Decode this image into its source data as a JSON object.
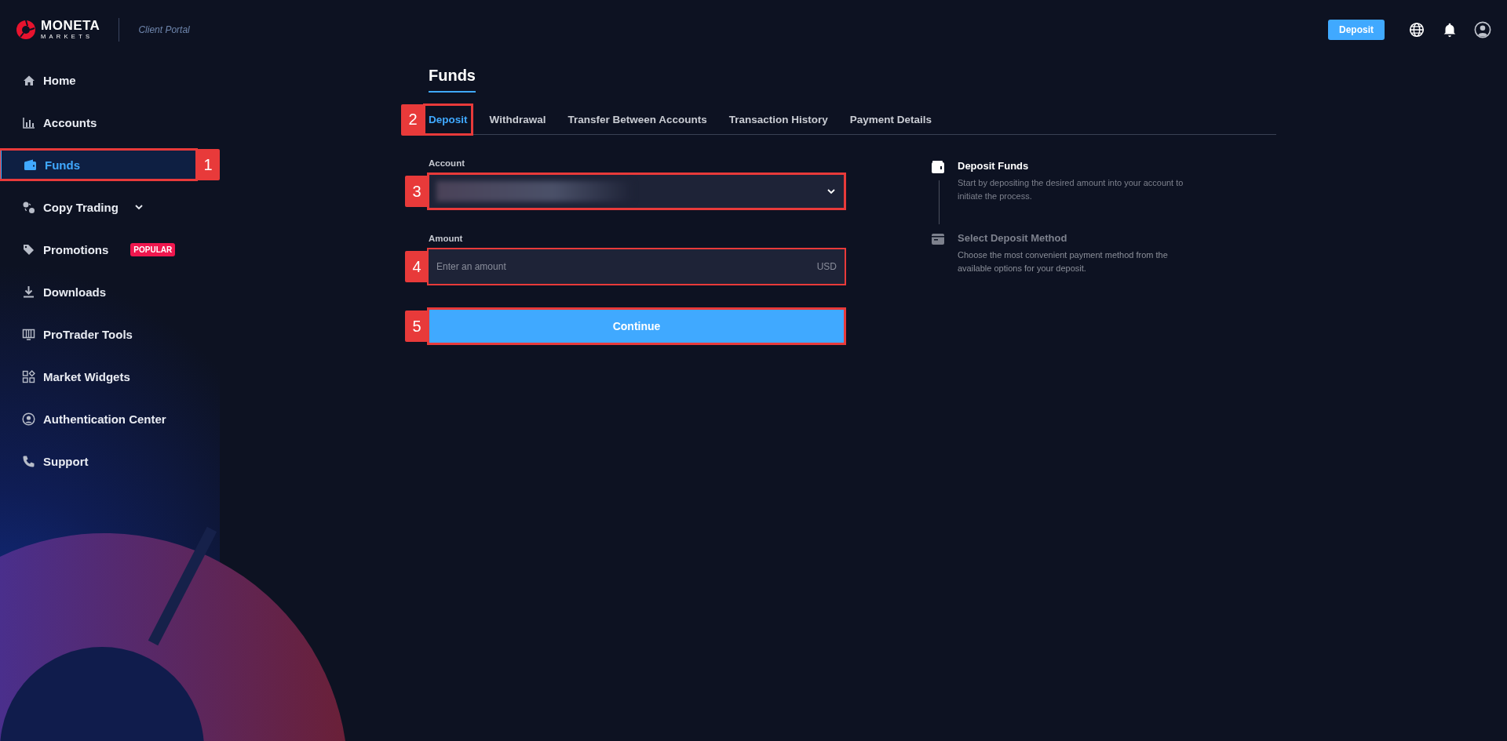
{
  "header": {
    "brand": "MONETA",
    "brand_sub": "MARKETS",
    "portal_label": "Client Portal",
    "deposit_button": "Deposit"
  },
  "sidebar": {
    "items": [
      {
        "label": "Home",
        "kind": "link",
        "selected": false
      },
      {
        "label": "Accounts",
        "kind": "link",
        "selected": false
      },
      {
        "label": "Funds",
        "kind": "link",
        "selected": true,
        "annotation": "1"
      },
      {
        "label": "Copy Trading",
        "kind": "group",
        "selected": false,
        "expanded": false
      },
      {
        "label": "Promotions",
        "kind": "link",
        "selected": false,
        "badge": "POPULAR"
      },
      {
        "label": "Downloads",
        "kind": "link",
        "selected": false
      },
      {
        "label": "ProTrader Tools",
        "kind": "link",
        "selected": false
      },
      {
        "label": "Market Widgets",
        "kind": "link",
        "selected": false
      },
      {
        "label": "Authentication Center",
        "kind": "link",
        "selected": false
      },
      {
        "label": "Support",
        "kind": "link",
        "selected": false
      }
    ]
  },
  "page": {
    "title": "Funds",
    "tabs": [
      {
        "label": "Deposit",
        "selected": true,
        "annotation": "2"
      },
      {
        "label": "Withdrawal",
        "selected": false
      },
      {
        "label": "Transfer Between Accounts",
        "selected": false
      },
      {
        "label": "Transaction History",
        "selected": false
      },
      {
        "label": "Payment Details",
        "selected": false
      }
    ],
    "form": {
      "fields": [
        {
          "kind": "select",
          "label": "Account",
          "redacted": true,
          "annotation": "3"
        },
        {
          "kind": "input",
          "label": "Amount",
          "placeholder": "Enter an amount",
          "suffix": "USD",
          "annotation": "4"
        }
      ],
      "submit": {
        "label": "Continue",
        "annotation": "5"
      }
    },
    "steps": [
      {
        "title": "Deposit Funds",
        "description": "Start by depositing the desired amount into your account to initiate the process.",
        "active": true
      },
      {
        "title": "Select Deposit Method",
        "description": "Choose the most convenient payment method from the available options for your deposit.",
        "active": false
      }
    ]
  }
}
